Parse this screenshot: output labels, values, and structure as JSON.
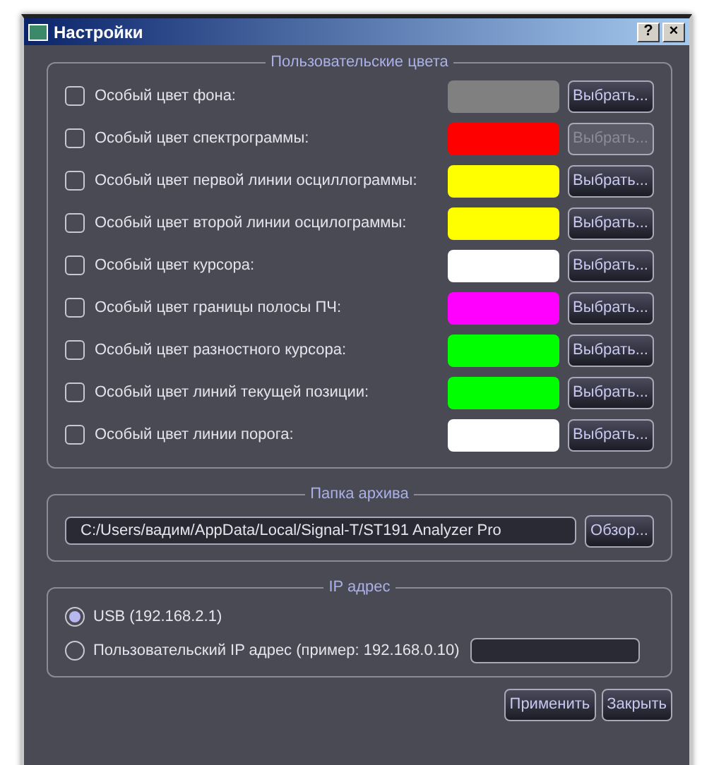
{
  "window": {
    "title": "Настройки",
    "help": "?",
    "close": "×"
  },
  "colors_group": {
    "title": "Пользовательские цвета",
    "rows": [
      {
        "label": "Особый цвет фона:",
        "checked": false,
        "color": "#808080",
        "button": "Выбрать...",
        "disabled": false
      },
      {
        "label": "Особый цвет спектрограммы:",
        "checked": false,
        "color": "#ff0000",
        "button": "Выбрать...",
        "disabled": true
      },
      {
        "label": "Особый цвет первой линии осциллограммы:",
        "checked": false,
        "color": "#ffff00",
        "button": "Выбрать...",
        "disabled": false
      },
      {
        "label": "Особый цвет второй линии осцилограммы:",
        "checked": false,
        "color": "#ffff00",
        "button": "Выбрать...",
        "disabled": false
      },
      {
        "label": "Особый цвет курсора:",
        "checked": false,
        "color": "#ffffff",
        "button": "Выбрать...",
        "disabled": false
      },
      {
        "label": "Особый цвет границы полосы ПЧ:",
        "checked": false,
        "color": "#ff00ff",
        "button": "Выбрать...",
        "disabled": false
      },
      {
        "label": "Особый цвет разностного курсора:",
        "checked": false,
        "color": "#00ff00",
        "button": "Выбрать...",
        "disabled": false
      },
      {
        "label": "Особый цвет линий текущей позиции:",
        "checked": false,
        "color": "#00ff00",
        "button": "Выбрать...",
        "disabled": false
      },
      {
        "label": "Особый цвет линии порога:",
        "checked": false,
        "color": "#ffffff",
        "button": "Выбрать...",
        "disabled": false
      }
    ]
  },
  "archive_group": {
    "title": "Папка архива",
    "path": "C:/Users/вадим/AppData/Local/Signal-T/ST191 Analyzer Pro",
    "button": "Обзор..."
  },
  "ip_group": {
    "title": "IP адрес",
    "options": [
      {
        "label": "USB (192.168.2.1)",
        "selected": true,
        "has_field": false
      },
      {
        "label": "Пользовательский IP адрес (пример: 192.168.0.10)",
        "selected": false,
        "has_field": true
      }
    ]
  },
  "buttons": [
    "Применить",
    "Закрыть"
  ]
}
